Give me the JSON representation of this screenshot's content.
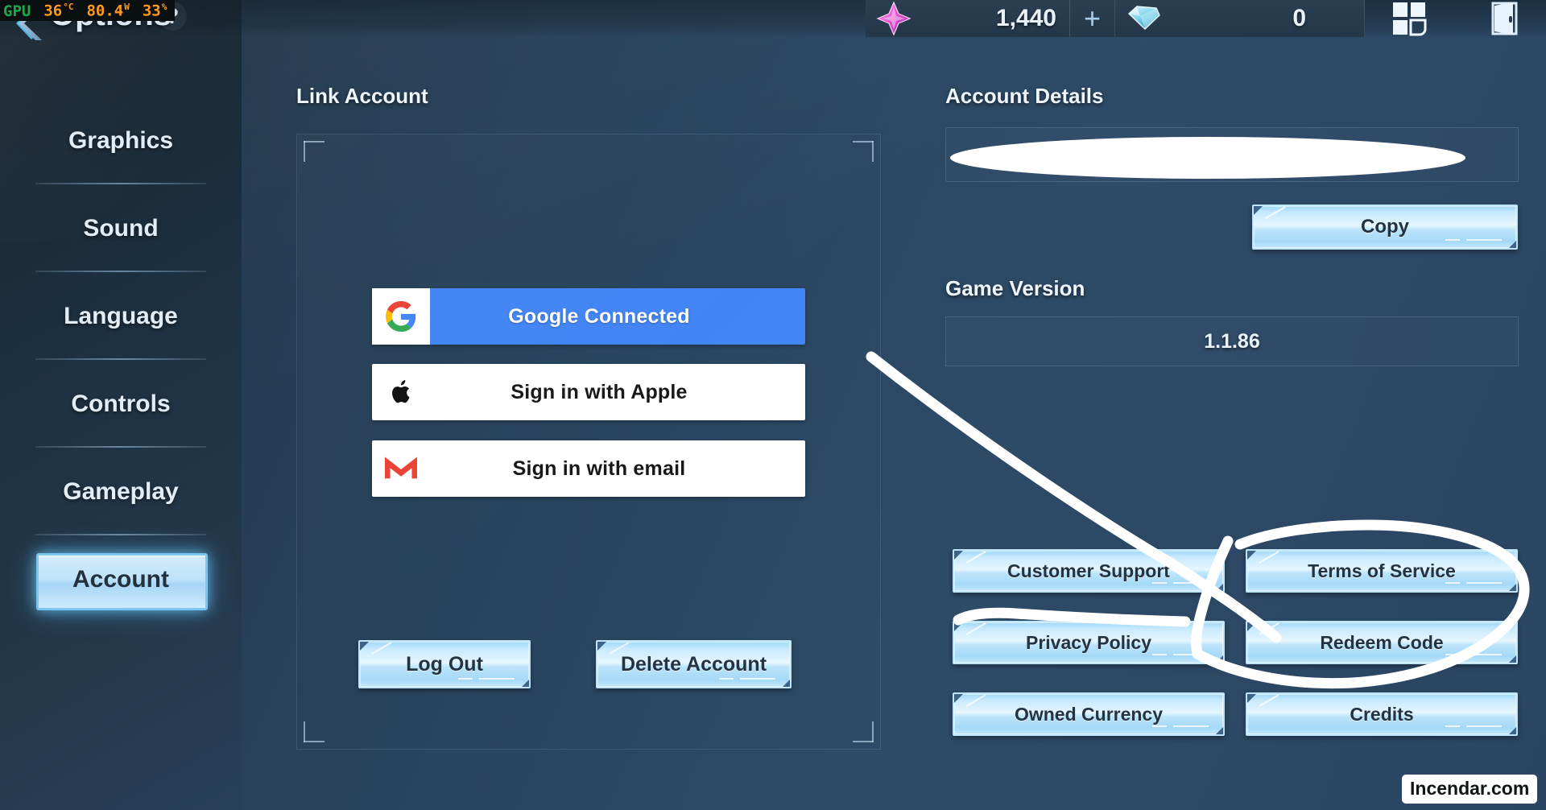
{
  "overlay": {
    "gpu_label": "GPU",
    "temp": "36",
    "temp_unit": "°C",
    "power": "80.4",
    "power_unit": "W",
    "usage": "33",
    "usage_unit": "%"
  },
  "header": {
    "title": "Options",
    "help_label": "?",
    "back_icon": "back-arrow-icon",
    "currencies": [
      {
        "icon": "shard-icon",
        "value": "1,440",
        "plus_label": "+"
      },
      {
        "icon": "gem-icon",
        "value": "0",
        "plus_label": ""
      }
    ],
    "grid_icon": "grid-menu-icon",
    "exit_icon": "exit-door-icon"
  },
  "sidebar": {
    "items": [
      {
        "label": "Graphics",
        "active": false
      },
      {
        "label": "Sound",
        "active": false
      },
      {
        "label": "Language",
        "active": false
      },
      {
        "label": "Controls",
        "active": false
      },
      {
        "label": "Gameplay",
        "active": false
      },
      {
        "label": "Account",
        "active": true
      }
    ]
  },
  "link_account": {
    "title": "Link Account",
    "providers": [
      {
        "label": "Google Connected",
        "icon": "google-g-icon",
        "state": "connected"
      },
      {
        "label": "Sign in with Apple",
        "icon": "apple-logo-icon",
        "state": "available"
      },
      {
        "label": "Sign in with email",
        "icon": "gmail-m-icon",
        "state": "available"
      }
    ],
    "log_out_label": "Log Out",
    "delete_account_label": "Delete Account"
  },
  "account_details": {
    "title": "Account Details",
    "account_id": "",
    "account_id_redacted": true,
    "copy_label": "Copy"
  },
  "game_version": {
    "title": "Game Version",
    "value": "1.1.86"
  },
  "links_grid": [
    {
      "label": "Customer Support"
    },
    {
      "label": "Terms of Service"
    },
    {
      "label": "Privacy Policy"
    },
    {
      "label": "Redeem Code"
    },
    {
      "label": "Owned Currency"
    },
    {
      "label": "Credits"
    }
  ],
  "annotation": {
    "type": "hand-drawn-arrow-circle",
    "color": "#ffffff",
    "targets": "Redeem Code"
  },
  "watermark": {
    "text": "Incendar.com"
  },
  "colors": {
    "background": "#2a4561",
    "sidebar": "#1d3040",
    "button_blue": "#c8eafd",
    "google_blue": "#4285f4",
    "accent_glow": "#7cc6f2",
    "overlay_orange": "#ff9a1e",
    "overlay_green": "#1fa84a"
  }
}
